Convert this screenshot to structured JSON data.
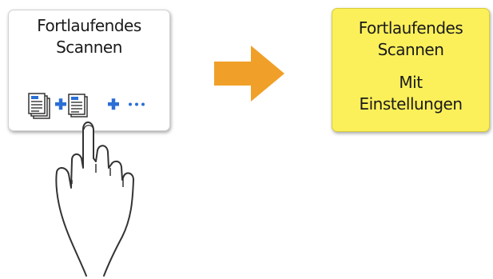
{
  "left_button": {
    "title_line1": "Fortlaufendes",
    "title_line2": "Scannen",
    "icon_names": [
      "document-stack-icon",
      "plus-icon",
      "document-icon",
      "plus-icon",
      "ellipsis-icon"
    ]
  },
  "right_button": {
    "title_line1": "Fortlaufendes",
    "title_line2": "Scannen",
    "sub_line1": "Mit",
    "sub_line2": "Einstellungen"
  },
  "colors": {
    "arrow": "#f0a028",
    "highlight": "#fbf05a",
    "icon_blue": "#2a6fd6"
  },
  "icons": {
    "arrow": "arrow-right-icon",
    "hand": "pointing-hand-icon"
  }
}
